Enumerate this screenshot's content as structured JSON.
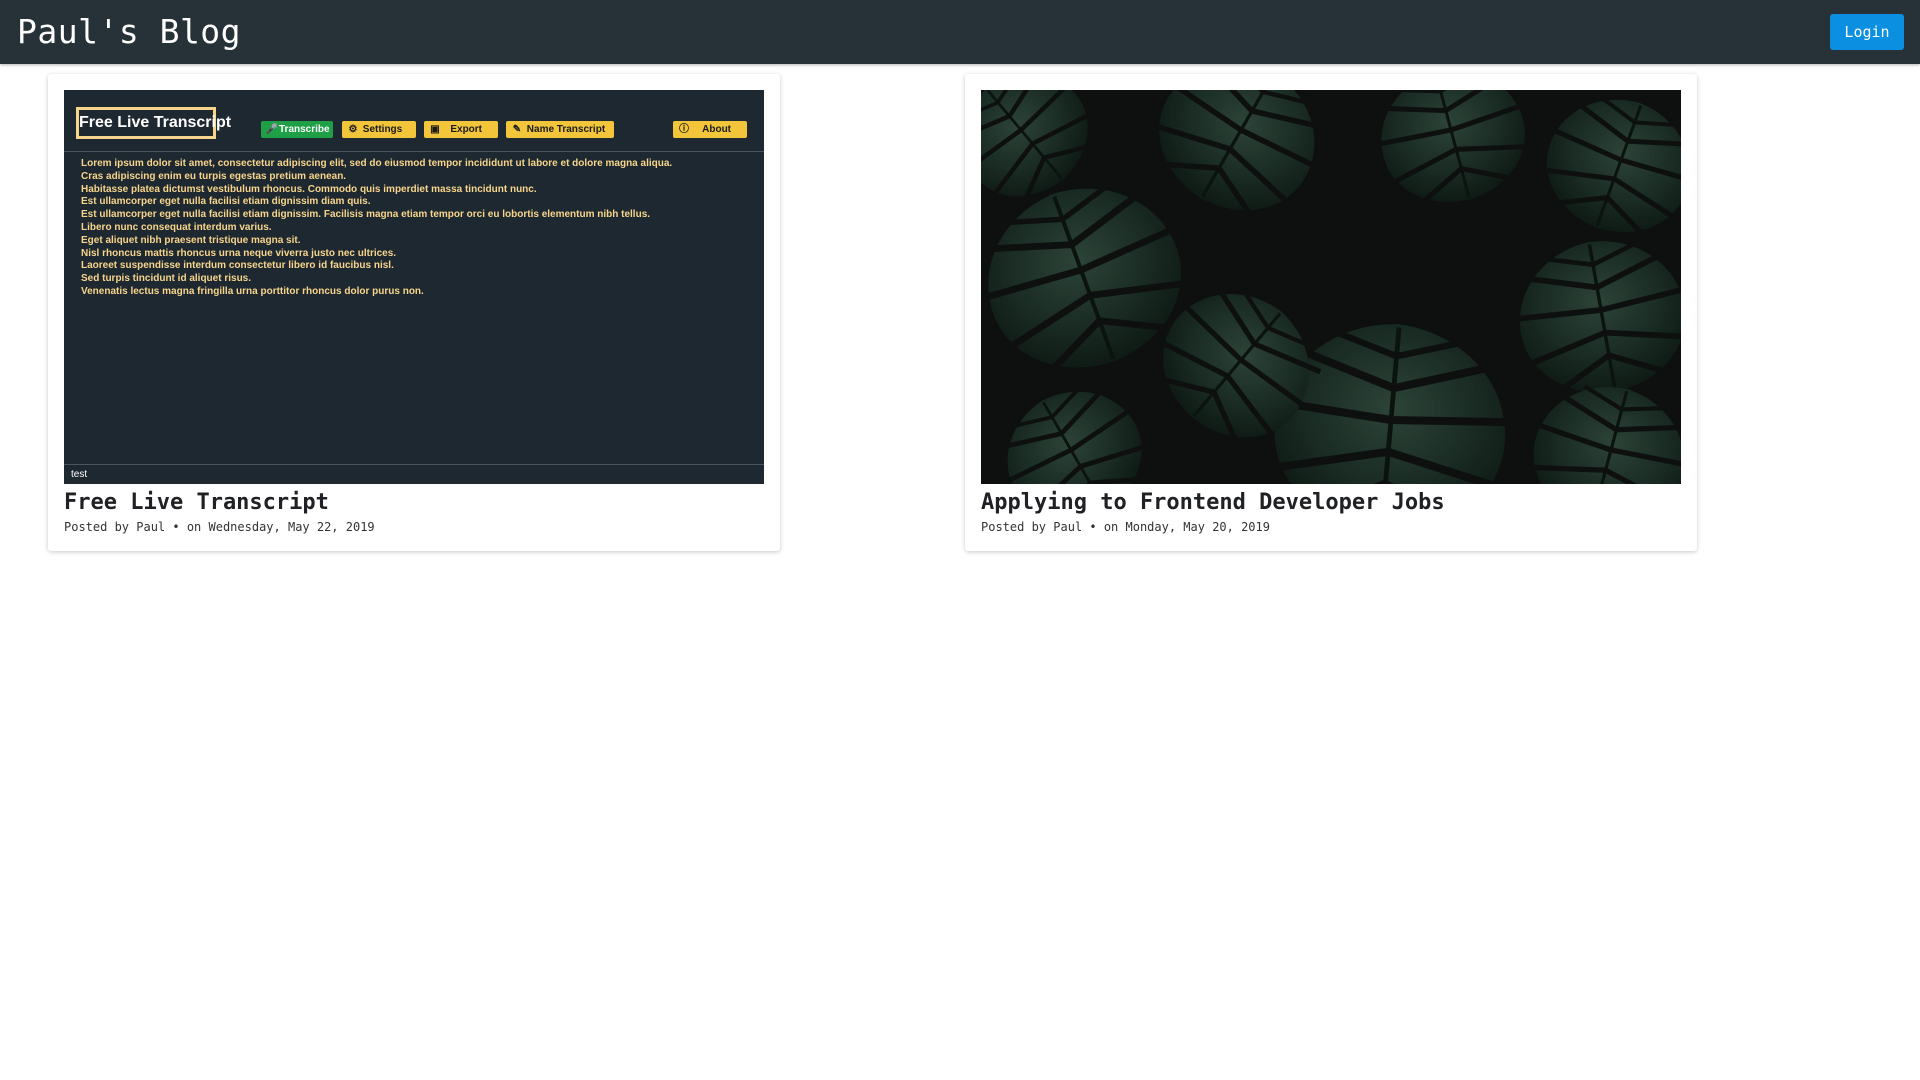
{
  "header": {
    "brand": "Paul's Blog",
    "login_label": "Login",
    "background": "#263238",
    "login_color": "#0a8fe1"
  },
  "posts": [
    {
      "title": "Free Live Transcript",
      "meta": "Posted by Paul • on Wednesday, May 22, 2019",
      "thumbnail": {
        "kind": "app-screenshot",
        "logo": "Free Live Transcript",
        "buttons": [
          {
            "label": "Transcribe",
            "icon": "microphone-icon",
            "color": "#1fa046"
          },
          {
            "label": "Settings",
            "icon": "gear-icon",
            "color": "#f2c53a"
          },
          {
            "label": "Export",
            "icon": "export-icon",
            "color": "#f2c53a"
          },
          {
            "label": "Name Transcript",
            "icon": "pencil-icon",
            "color": "#f2c53a"
          },
          {
            "label": "About",
            "icon": "info-icon",
            "color": "#f2c53a"
          }
        ],
        "lines": [
          "Lorem ipsum dolor sit amet, consectetur adipiscing elit, sed do eiusmod tempor incididunt ut labore et dolore magna aliqua.",
          "Cras adipiscing enim eu turpis egestas pretium aenean.",
          "Habitasse platea dictumst vestibulum rhoncus. Commodo quis imperdiet massa tincidunt nunc.",
          "Est ullamcorper eget nulla facilisi etiam dignissim diam quis.",
          "Est ullamcorper eget nulla facilisi etiam dignissim. Facilisis magna etiam tempor orci eu lobortis elementum nibh tellus.",
          "Libero nunc consequat interdum varius.",
          "Eget aliquet nibh praesent tristique magna sit.",
          "Nisl rhoncus mattis rhoncus urna neque viverra justo nec ultrices.",
          "Laoreet suspendisse interdum consectetur libero id faucibus nisl.",
          "Sed turpis tincidunt id aliquet risus.",
          "Venenatis lectus magna fringilla urna porttitor rhoncus dolor purus non."
        ],
        "footer": "test"
      }
    },
    {
      "title": "Applying to Frontend Developer Jobs",
      "meta": "Posted by Paul • on Monday, May 20, 2019",
      "thumbnail": {
        "kind": "photo",
        "subject": "dark-green-monstera-leaves"
      }
    }
  ]
}
